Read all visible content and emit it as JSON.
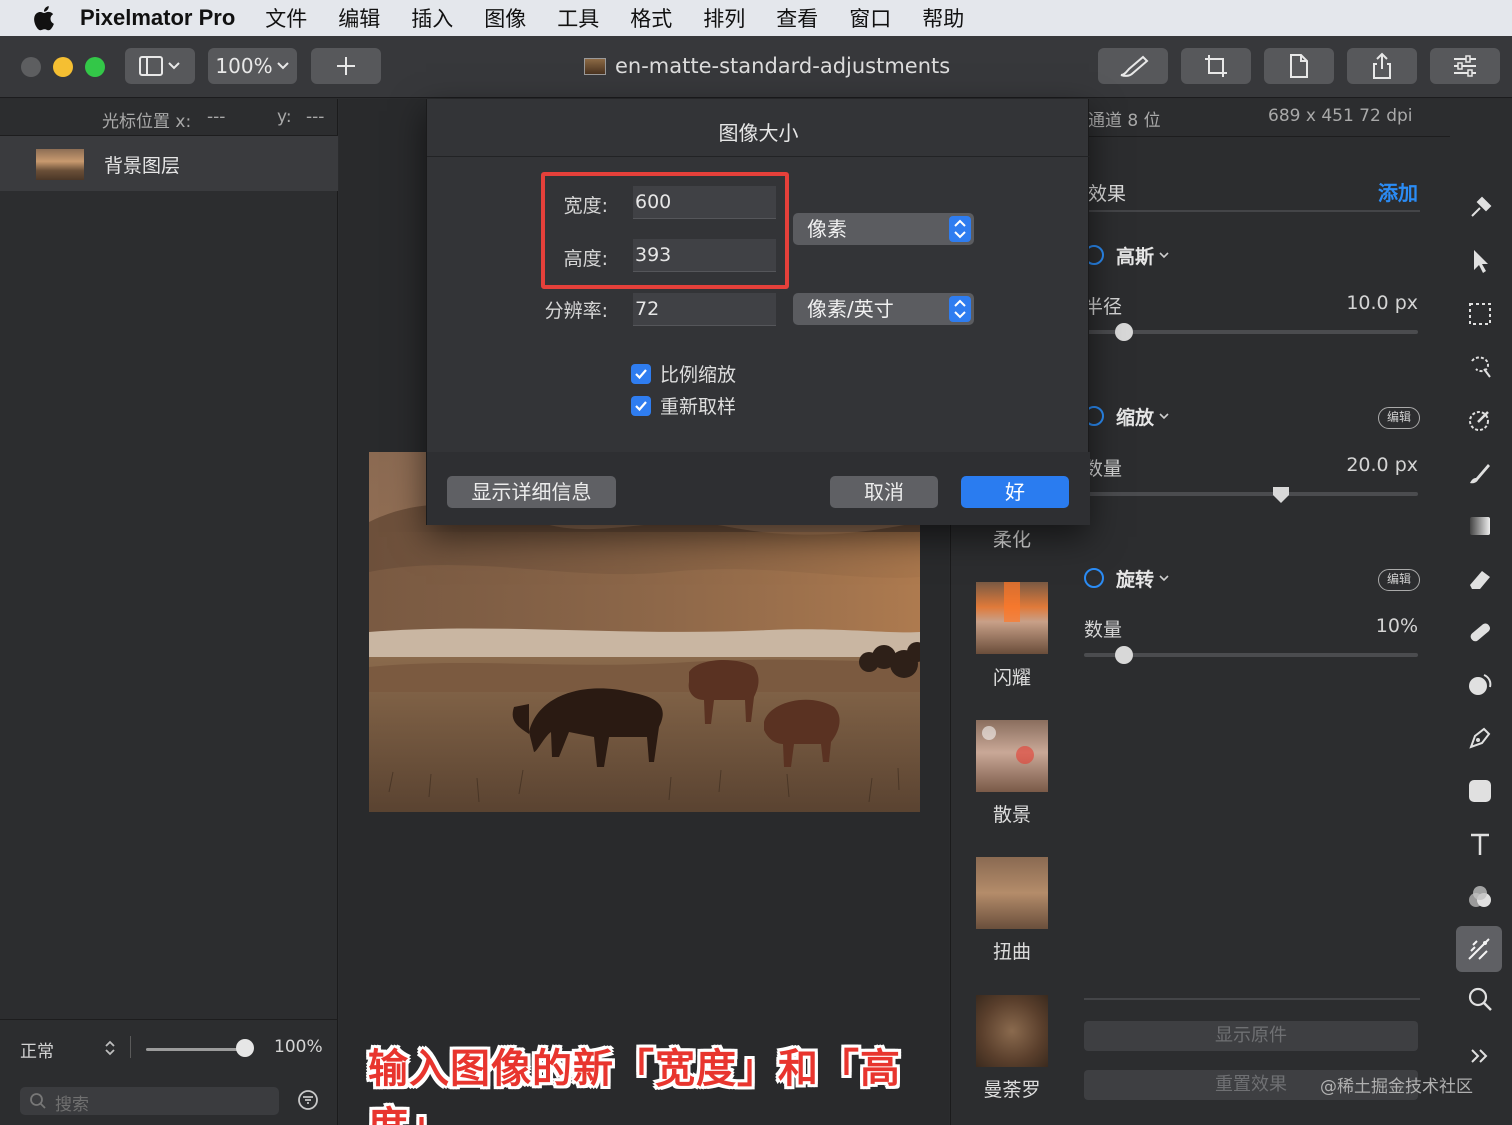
{
  "menubar": {
    "app_name": "Pixelmator Pro",
    "items": [
      "文件",
      "编辑",
      "插入",
      "图像",
      "工具",
      "格式",
      "排列",
      "查看",
      "窗口",
      "帮助"
    ]
  },
  "toolbar": {
    "zoom_label": "100%",
    "document_title": "en-matte-standard-adjustments"
  },
  "left_panel": {
    "cursor_x_label": "光标位置 x:",
    "cursor_x_value": "---",
    "cursor_y_label": "y:",
    "cursor_y_value": "---",
    "layer_name": "背景图层",
    "blend_mode": "正常",
    "opacity": "100%",
    "search_placeholder": "搜索"
  },
  "canvas": {
    "caption": "输入图像的新「宽度」和「高度」"
  },
  "effects_browser": {
    "items": [
      {
        "label": "柔化"
      },
      {
        "label": "闪耀"
      },
      {
        "label": "散景"
      },
      {
        "label": "扭曲"
      },
      {
        "label": "曼荼罗"
      }
    ]
  },
  "right_panel": {
    "info_channel": "通道 8 位",
    "info_size": "689 x 451 72 dpi",
    "section_title": "效果",
    "add_label": "添加",
    "effects": [
      {
        "name": "高斯",
        "param": "半径",
        "value": "10.0 px",
        "level": 0.12
      },
      {
        "name": "缩放",
        "param": "数量",
        "value": "20.0 px",
        "level": 0.59,
        "badge": "编辑"
      },
      {
        "name": "旋转",
        "param": "数量",
        "value": "10%",
        "level": 0.12,
        "badge": "编辑"
      }
    ],
    "show_original": "显示原件",
    "reset_effects": "重置效果"
  },
  "dialog": {
    "title": "图像大小",
    "width_label": "宽度:",
    "width_value": "600",
    "height_label": "高度:",
    "height_value": "393",
    "resolution_label": "分辨率:",
    "resolution_value": "72",
    "size_unit": "像素",
    "resolution_unit": "像素/英寸",
    "proportional_label": "比例缩放",
    "resample_label": "重新取样",
    "details_button": "显示详细信息",
    "cancel_button": "取消",
    "ok_button": "好"
  },
  "watermark": "@稀土掘金技术社区",
  "colors": {
    "accent_blue": "#2a7cf0",
    "highlight_red": "#e5403a",
    "caption_red": "#e8352e"
  }
}
